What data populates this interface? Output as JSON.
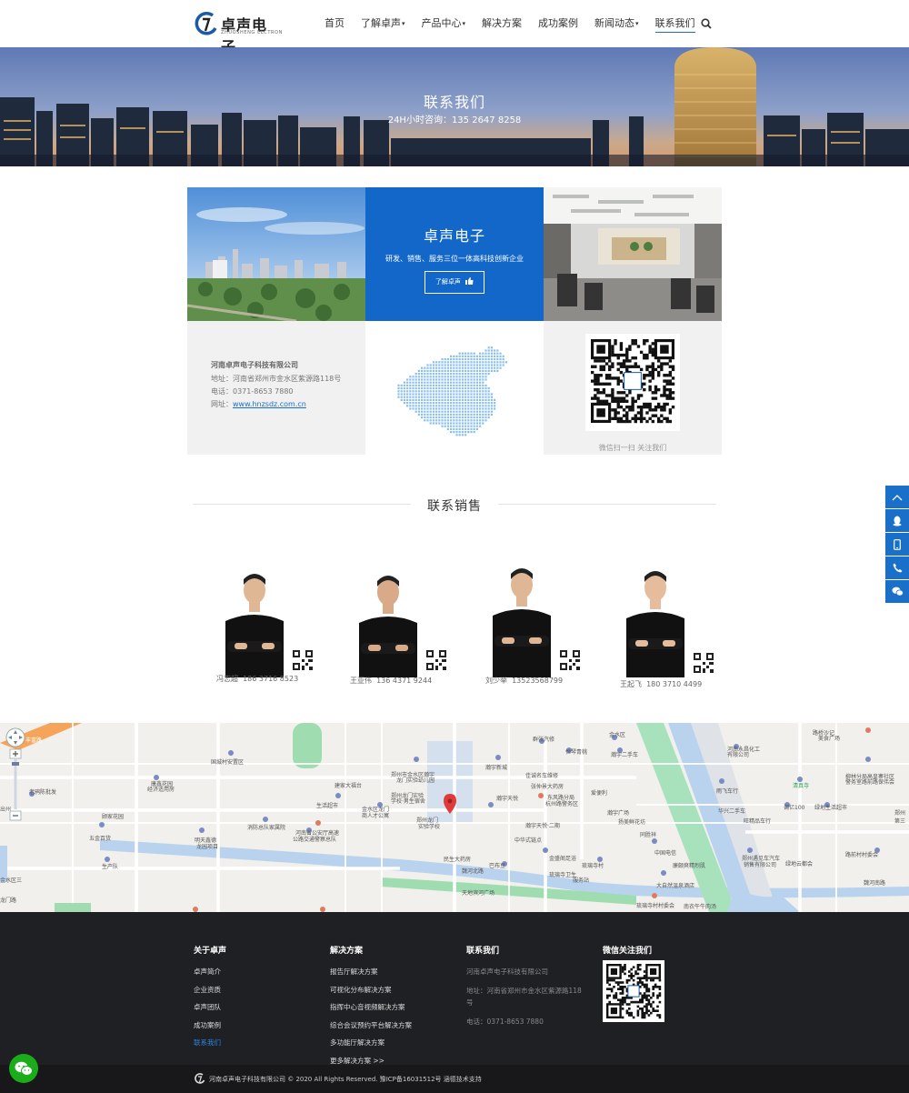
{
  "header": {
    "logo_text": "卓声电子",
    "logo_sub": "ZHUOSHENG ELCTRON",
    "nav": [
      {
        "label": "首页",
        "dropdown": false,
        "active": false
      },
      {
        "label": "了解卓声",
        "dropdown": true,
        "active": false
      },
      {
        "label": "产品中心",
        "dropdown": true,
        "active": false
      },
      {
        "label": "解决方案",
        "dropdown": false,
        "active": false
      },
      {
        "label": "成功案例",
        "dropdown": false,
        "active": false
      },
      {
        "label": "新闻动态",
        "dropdown": true,
        "active": false
      },
      {
        "label": "联系我们",
        "dropdown": false,
        "active": true
      }
    ]
  },
  "banner": {
    "title": "联系我们",
    "subtitle": "24H小时咨询：135 2647 8258"
  },
  "brand": {
    "title": "卓声电子",
    "desc": "研发、销售、服务三位一体高科技创新企业",
    "button": "了解卓声"
  },
  "company": {
    "name": "河南卓声电子科技有限公司",
    "address": "地址：河南省郑州市金水区紫源路118号",
    "phone": "电话：0371-8653 7880",
    "site_label": "网址：",
    "site_url": "www.hnzsdz.com.cn"
  },
  "qr_caption": "微信扫一扫 关注我们",
  "sales": {
    "title": "联系销售",
    "people": [
      {
        "name": "冯志超",
        "phone": "186 3716 8523"
      },
      {
        "name": "王亚伟",
        "phone": "136 4371 9244"
      },
      {
        "name": "刘少举",
        "phone": "13523568799"
      },
      {
        "name": "王起飞",
        "phone": "180 3710 4499"
      }
    ]
  },
  "map": {
    "labels": [
      {
        "t": "丰富路",
        "c": "#fff"
      },
      {
        "t": "国城村安置区"
      },
      {
        "t": "康鑫花园"
      },
      {
        "t": "经济适用房"
      },
      {
        "t": "老鸦陈批发"
      },
      {
        "t": "顾家花园"
      },
      {
        "t": "五金百货"
      },
      {
        "t": "明天鑫德"
      },
      {
        "t": "龙园项目"
      },
      {
        "t": "生产队"
      },
      {
        "t": "消防总队家属院"
      },
      {
        "t": "河南省公安厅高速"
      },
      {
        "t": "公路交通警察总队"
      },
      {
        "t": "生活超市"
      },
      {
        "t": "建家大福台"
      },
      {
        "t": "金水区龙门"
      },
      {
        "t": "商人才公寓"
      },
      {
        "t": "郑州市金水区瀚宇"
      },
      {
        "t": "龙门实验幼儿园"
      },
      {
        "t": "郑州龙门实验"
      },
      {
        "t": "学校·男生宿舍"
      },
      {
        "t": "郑州龙门"
      },
      {
        "t": "实验学校"
      },
      {
        "t": "民生大药房"
      },
      {
        "t": "巴布豆"
      },
      {
        "t": "魏河北路"
      },
      {
        "t": "天地滨河广场"
      },
      {
        "t": "金水区"
      },
      {
        "t": "群张汽修"
      },
      {
        "t": "恒琴青桃"
      },
      {
        "t": "瀚宇新城"
      },
      {
        "t": "佳诚名车维修"
      },
      {
        "t": "张仲景大药房"
      },
      {
        "t": "东风路分局"
      },
      {
        "t": "杭州路警务区"
      },
      {
        "t": "瀚宇天悦"
      },
      {
        "t": "瀚宇天悦·二期"
      },
      {
        "t": "中华式链点"
      },
      {
        "t": "金盛阁足浴"
      },
      {
        "t": "琉璃寺卫生"
      },
      {
        "t": "服务站"
      },
      {
        "t": "琉璃寺村"
      },
      {
        "t": "瀚宇广场"
      },
      {
        "t": "瀚宇二手车"
      },
      {
        "t": "爱便利"
      },
      {
        "t": "扬美鲜花坊"
      },
      {
        "t": "同胜祥"
      },
      {
        "t": "中国电信"
      },
      {
        "t": "廉颇爽精烈肌"
      },
      {
        "t": "大自然温泉酒店"
      },
      {
        "t": "琉璃寺村村委会"
      },
      {
        "t": "南衣午牛肉汤"
      },
      {
        "t": "路桥沙记"
      },
      {
        "t": "美食广场"
      },
      {
        "t": "河南永昌化工"
      },
      {
        "t": "有限公司"
      },
      {
        "t": "雨飞车行"
      },
      {
        "t": "清真寺"
      },
      {
        "t": "柳林分局高皇寨社区"
      },
      {
        "t": "警务室路前路保伟会"
      },
      {
        "t": "华兴二手车"
      },
      {
        "t": "调亿100"
      },
      {
        "t": "绿地生活超市"
      },
      {
        "t": "旺精品车行"
      },
      {
        "t": "郑州遇见车汽车"
      },
      {
        "t": "销售有限公司"
      },
      {
        "t": "绿地云都会"
      },
      {
        "t": "路前村村委会"
      },
      {
        "t": "魏河南路"
      },
      {
        "t": "郑州"
      },
      {
        "t": "第三"
      },
      {
        "t": "出州"
      },
      {
        "t": "金水区三"
      },
      {
        "t": "龙门路"
      }
    ]
  },
  "footer": {
    "col1": {
      "title": "关于卓声",
      "links": [
        "卓声简介",
        "企业资质",
        "卓声团队",
        "成功案例",
        "联系我们"
      ],
      "active_index": 4
    },
    "col2": {
      "title": "解决方案",
      "links": [
        "报告厅解决方案",
        "可视化分布解决方案",
        "指挥中心音视频解决方案",
        "综合会议预约平台解决方案",
        "多功能厅解决方案",
        "更多解决方案 >>"
      ]
    },
    "col3": {
      "title": "联系我们",
      "company": "河南卓声电子科技有限公司",
      "address1": "地址：河南省郑州市金水区紫源路118",
      "address2": "号",
      "phone": "电话：0371-8653 7880"
    },
    "col4": {
      "title": "微信关注我们"
    },
    "copyright": "河南卓声电子科技有限公司 © 2020 All Rights Reserved. 豫ICP备16031512号  涵德技术支持"
  },
  "colors": {
    "brand_blue": "#1267c9",
    "float_blue": "#1a6fc9",
    "footer_bg": "#1f2024",
    "bottom_bg": "#18181b",
    "wechat_green": "#1aad19"
  },
  "icons": [
    "search-icon",
    "thumbs-up-icon",
    "china-map-icon",
    "qr-code-icon",
    "arrow-up-icon",
    "qq-icon",
    "mobile-icon",
    "phone-icon",
    "wechat-icon",
    "map-pin-icon",
    "map-zoom-in-icon",
    "map-zoom-out-icon",
    "map-pan-icon"
  ]
}
